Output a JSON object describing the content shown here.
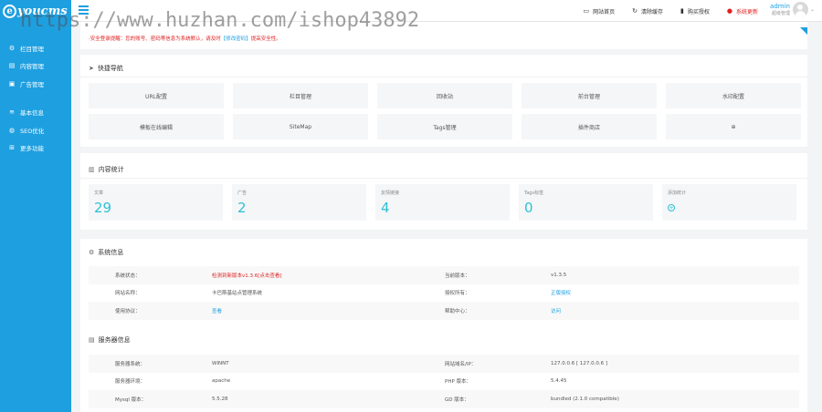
{
  "sidebar": {
    "logo": "youcms",
    "items": [
      {
        "label": "栏目管理",
        "icon": "gear-icon"
      },
      {
        "label": "内容管理",
        "icon": "document-icon"
      },
      {
        "label": "广告管理",
        "icon": "image-icon"
      },
      {
        "label": "基本信息",
        "icon": "layers-icon"
      },
      {
        "label": "SEO优化",
        "icon": "globe-icon"
      },
      {
        "label": "更多功能",
        "icon": "grid-icon"
      }
    ]
  },
  "topbar": {
    "links": [
      {
        "label": "网站首页",
        "icon": "monitor-icon"
      },
      {
        "label": "清除缓存",
        "icon": "refresh-icon"
      },
      {
        "label": "购买授权",
        "icon": "bookmark-icon"
      },
      {
        "label": "系统更新",
        "icon": "info-icon"
      }
    ],
    "user": {
      "name": "admin",
      "role": "超级管理"
    }
  },
  "watermark": "https://www.huzhan.com/ishop43892",
  "notice": {
    "text": "·安全登录提醒：您的账号、密码等信息为系统默认，请及时",
    "link": "【修改密码】",
    "suffix": "提高安全性。"
  },
  "quick_nav": {
    "title": "快捷导航",
    "items": [
      "URL配置",
      "栏目管理",
      "回收站",
      "前台管理",
      "水印配置",
      "模板在线编辑",
      "SiteMap",
      "Tags管理",
      "插件商店",
      ""
    ]
  },
  "stats": {
    "title": "内容统计",
    "items": [
      {
        "label": "文章",
        "value": "29"
      },
      {
        "label": "广告",
        "value": "2"
      },
      {
        "label": "友情链接",
        "value": "4"
      },
      {
        "label": "Tags标签",
        "value": "0"
      },
      {
        "label": "添加统计",
        "value": ""
      }
    ]
  },
  "system": {
    "title": "系统信息",
    "rows": [
      {
        "k1": "系统状态：",
        "v1": "检测到新版本v1.3.6[点击查看]",
        "k2": "当前版本：",
        "v2": "v1.3.5"
      },
      {
        "k1": "网站名称：",
        "v1": "卡巴斯基站点管理系统",
        "k2": "授权所有：",
        "v2": "正版授权"
      },
      {
        "k1": "使用协议：",
        "v1": "查看",
        "k2": "帮助中心：",
        "v2": "访问"
      }
    ]
  },
  "server": {
    "title": "服务器信息",
    "rows": [
      {
        "k1": "服务器系统：",
        "v1": "WINNT",
        "k2": "网站域名/IP：",
        "v2": "127.0.0.6 [ 127.0.0.6 ]"
      },
      {
        "k1": "服务器环境：",
        "v1": "apache",
        "k2": "PHP 版本：",
        "v2": "5.4.45"
      },
      {
        "k1": "Mysql 版本：",
        "v1": "5.5.28",
        "k2": "GD 版本：",
        "v2": "bundled (2.1.0 compatible)"
      }
    ]
  }
}
